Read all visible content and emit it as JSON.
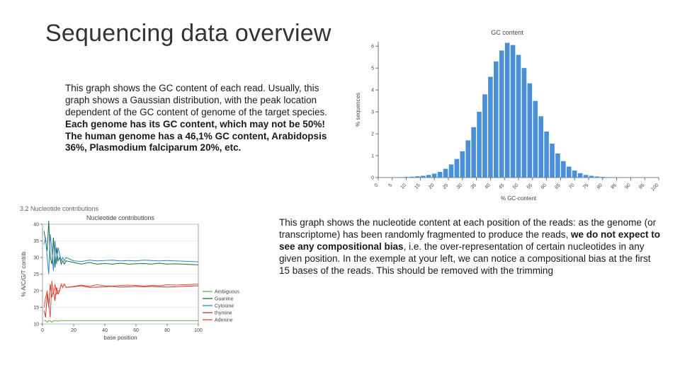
{
  "title": "Sequencing data overview",
  "top_text": {
    "p1": "This graph shows the GC content of each read. Usually, this graph shows a Gaussian distribution, with the peak location dependent of the GC content of genome of the target species.",
    "p2": "Each genome has its GC content, which may not be 50%! The human genome has a 46,1% GC content, Arabidopsis 36%, Plasmodium falciparum 20%, etc."
  },
  "bottom_text": {
    "p1a": "This graph shows the nucleotide content at each position of the reads: as the genome (or transcriptome) has been randomly fragmented to produce the reads, ",
    "p1b": "we do not expect to see any compositional bias",
    "p1c": ", i.e. the over-representation of certain nucleotides in any given position. In the exemple at your left, we can notice a compositional bias at the first 15 bases of the reads. This should be removed with the trimming"
  },
  "chart_data": [
    {
      "id": "gc_content",
      "type": "bar",
      "title": "GC content",
      "xlabel": "% GC-content",
      "ylabel": "% sequences",
      "x_ticks": [
        0,
        5,
        10,
        15,
        20,
        25,
        30,
        35,
        40,
        45,
        50,
        55,
        60,
        65,
        70,
        75,
        80,
        85,
        90,
        95,
        100
      ],
      "y_ticks": [
        0,
        1,
        2,
        3,
        4,
        5,
        6
      ],
      "ylim": [
        0,
        6.2
      ],
      "categories": [
        0,
        2,
        4,
        6,
        8,
        10,
        12,
        14,
        16,
        18,
        20,
        22,
        24,
        26,
        28,
        30,
        32,
        34,
        36,
        38,
        40,
        42,
        44,
        46,
        48,
        50,
        52,
        54,
        56,
        58,
        60,
        62,
        64,
        66,
        68,
        70,
        72,
        74,
        76,
        78,
        80,
        82,
        84,
        86,
        88,
        90,
        92,
        94,
        96,
        98,
        100
      ],
      "values": [
        0,
        0,
        0,
        0,
        0.02,
        0.03,
        0.04,
        0.06,
        0.08,
        0.12,
        0.18,
        0.26,
        0.4,
        0.6,
        0.85,
        1.2,
        1.7,
        2.3,
        3.0,
        3.8,
        4.6,
        5.3,
        5.8,
        6.15,
        6.05,
        5.6,
        5.0,
        4.3,
        3.5,
        2.8,
        2.1,
        1.55,
        1.1,
        0.75,
        0.5,
        0.32,
        0.2,
        0.12,
        0.08,
        0.05,
        0.03,
        0.02,
        0.015,
        0.01,
        0.005,
        0,
        0,
        0,
        0,
        0,
        0
      ]
    },
    {
      "id": "nucleotide_contributions",
      "type": "line",
      "section": "3.2 Nucleotide contributions",
      "title": "Nucleotide contributions",
      "xlabel": "base position",
      "ylabel": "% A/C/G/T contrib",
      "x_ticks": [
        0,
        20,
        40,
        60,
        80,
        100
      ],
      "y_ticks": [
        10,
        15,
        20,
        25,
        30,
        35,
        40
      ],
      "xlim": [
        0,
        100
      ],
      "ylim": [
        10,
        40
      ],
      "x": [
        1,
        2,
        3,
        4,
        5,
        6,
        7,
        8,
        9,
        10,
        11,
        12,
        13,
        14,
        15,
        20,
        25,
        30,
        35,
        40,
        45,
        50,
        55,
        60,
        65,
        70,
        75,
        80,
        85,
        90,
        95,
        100
      ],
      "series": [
        {
          "name": "Ambiguous",
          "color": "#6ab04c",
          "values": [
            11,
            11,
            10.5,
            11,
            11,
            10.5,
            11,
            11,
            11,
            10.8,
            11,
            11,
            11,
            11,
            11,
            11,
            11,
            11,
            11,
            11,
            11,
            11,
            11,
            11,
            11,
            11,
            11,
            11,
            11,
            11,
            11,
            11
          ]
        },
        {
          "name": "Guanine",
          "color": "#196f3d",
          "values": [
            38,
            35,
            32,
            41,
            30,
            28,
            36,
            27,
            33,
            29,
            30,
            28,
            29,
            28,
            29,
            28.5,
            28,
            28.5,
            28,
            28.2,
            28,
            28.3,
            28,
            28.1,
            28.2,
            28,
            28.3,
            28,
            28.1,
            28,
            27.9,
            27.8
          ]
        },
        {
          "name": "Cytosine",
          "color": "#2e86c1",
          "values": [
            34,
            36,
            30,
            25,
            37,
            32,
            26,
            35,
            28,
            33,
            31,
            29,
            30,
            29,
            30,
            29,
            28.8,
            29.2,
            29,
            29.1,
            29.2,
            29,
            29.1,
            29,
            29.2,
            29.1,
            29,
            29.1,
            29,
            28.9,
            28.8,
            28.7
          ]
        },
        {
          "name": "thymine",
          "color": "#c0392b",
          "values": [
            14,
            12,
            19,
            15,
            22,
            18,
            20,
            17,
            21,
            19,
            20,
            22,
            21,
            22,
            21,
            21.2,
            21.5,
            21,
            21.1,
            21.2,
            21.3,
            21.1,
            21.2,
            21.3,
            21.2,
            21.3,
            21.2,
            21.1,
            21.2,
            21.3,
            21.4,
            21.5
          ]
        },
        {
          "name": "Adenine",
          "color": "#e74c3c",
          "values": [
            15,
            18,
            20,
            16,
            12,
            23,
            19,
            22,
            19,
            20,
            20,
            22,
            21,
            22,
            21,
            21.3,
            21.7,
            21.3,
            21.8,
            21.5,
            21.4,
            21.6,
            21.7,
            21.6,
            21.4,
            21.6,
            21.5,
            21.8,
            21.7,
            21.8,
            21.9,
            22.0
          ]
        }
      ],
      "legend_position": "right"
    }
  ]
}
